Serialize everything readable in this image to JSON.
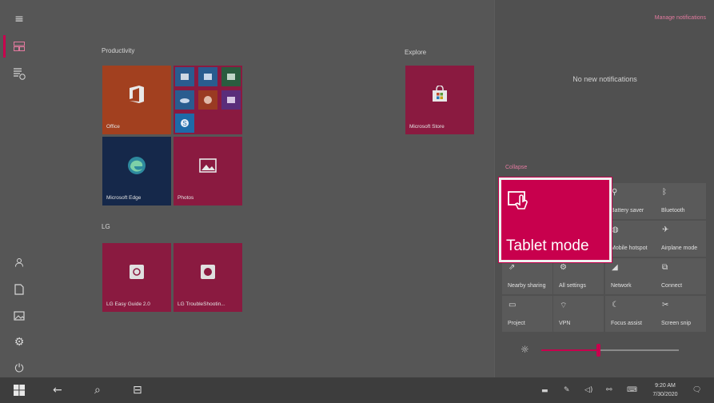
{
  "start": {
    "groups": {
      "productivity": "Productivity",
      "explore": "Explore",
      "lg": "LG"
    },
    "tiles": {
      "office": "Office",
      "edge": "Microsoft Edge",
      "photos": "Photos",
      "store": "Microsoft Store",
      "lg_guide": "LG Easy Guide 2.0",
      "lg_trouble": "LG TroubleShootin..."
    }
  },
  "action_center": {
    "manage": "Manage notifications",
    "no_notifications": "No new notifications",
    "collapse": "Collapse",
    "tablet_mode": "Tablet mode",
    "quick_actions": [
      {
        "label": "Battery saver",
        "icon": "battery-icon"
      },
      {
        "label": "Bluetooth",
        "icon": "bluetooth-icon"
      },
      {
        "label": "Mobile hotspot",
        "icon": "hotspot-icon"
      },
      {
        "label": "Airplane mode",
        "icon": "airplane-icon"
      },
      {
        "label": "Nearby sharing",
        "icon": "share-icon"
      },
      {
        "label": "All settings",
        "icon": "settings-icon"
      },
      {
        "label": "Network",
        "icon": "network-icon"
      },
      {
        "label": "Connect",
        "icon": "connect-icon"
      },
      {
        "label": "Project",
        "icon": "project-icon"
      },
      {
        "label": "VPN",
        "icon": "vpn-icon"
      },
      {
        "label": "Focus assist",
        "icon": "moon-icon"
      },
      {
        "label": "Screen snip",
        "icon": "snip-icon"
      }
    ],
    "brightness": 0.41
  },
  "taskbar": {
    "time": "9:20 AM",
    "date": "7/30/2020"
  },
  "colors": {
    "accent": "#c8004d",
    "office": "#b8361b",
    "edge": "#0f2b52",
    "apps_blue": "#1e4a7a"
  }
}
